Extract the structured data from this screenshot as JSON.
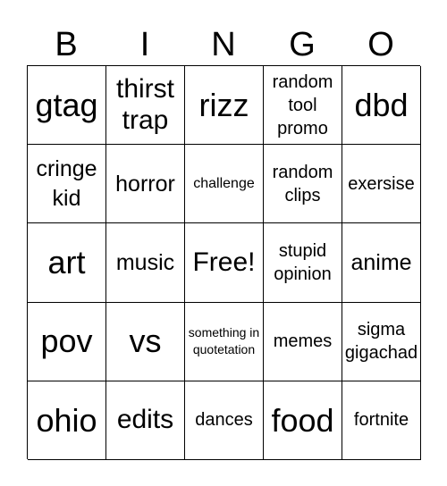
{
  "header": [
    "B",
    "I",
    "N",
    "G",
    "O"
  ],
  "cells": [
    "gtag",
    "thirst trap",
    "rizz",
    "random tool promo",
    "dbd",
    "cringe kid",
    "horror",
    "challenge",
    "random clips",
    "exersise",
    "art",
    "music",
    "Free!",
    "stupid opinion",
    "anime",
    "pov",
    "vs",
    "something in quotetation",
    "memes",
    "sigma gigachad",
    "ohio",
    "edits",
    "dances",
    "food",
    "fortnite"
  ]
}
